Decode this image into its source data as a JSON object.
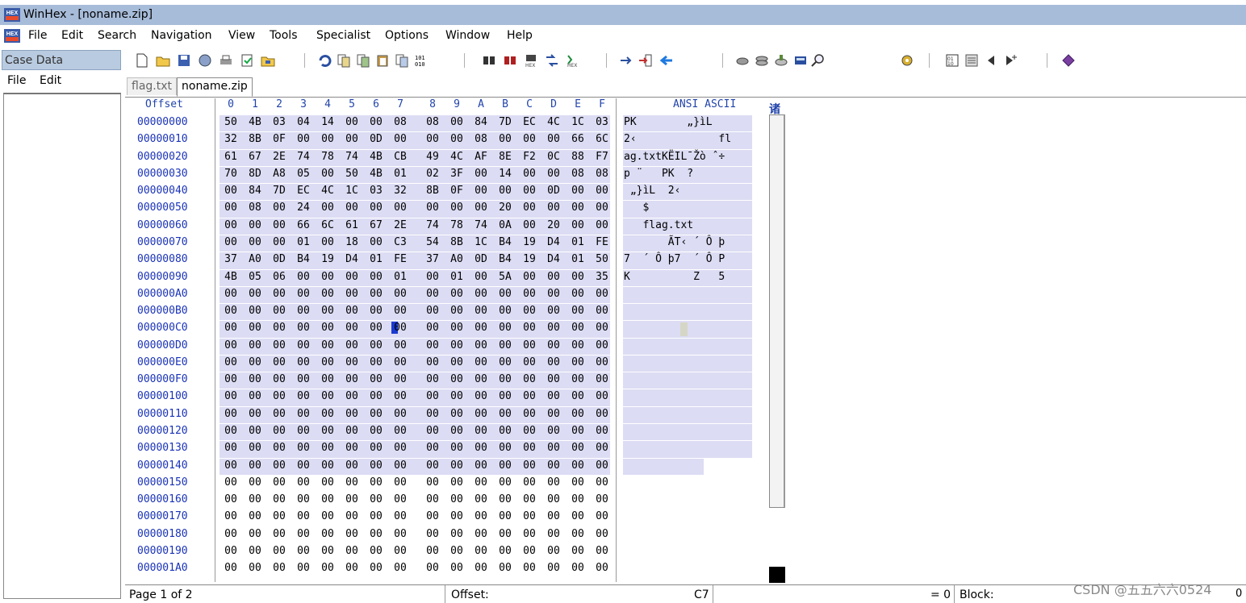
{
  "window": {
    "title": "WinHex - [noname.zip]"
  },
  "menu": [
    "File",
    "Edit",
    "Search",
    "Navigation",
    "View",
    "Tools",
    "Specialist",
    "Options",
    "Window",
    "Help"
  ],
  "case_panel": {
    "header": "Case Data",
    "menu": [
      "File",
      "Edit"
    ]
  },
  "tabs": [
    "flag.txt",
    "noname.zip"
  ],
  "hex_header": {
    "offset_label": "Offset",
    "columns": [
      "0",
      "1",
      "2",
      "3",
      "4",
      "5",
      "6",
      "7",
      "8",
      "9",
      "A",
      "B",
      "C",
      "D",
      "E",
      "F"
    ],
    "ansi_label": "ANSI ASCII",
    "extra": "诸"
  },
  "rows": [
    {
      "offset": "00000000",
      "bytes": [
        "50",
        "4B",
        "03",
        "04",
        "14",
        "00",
        "00",
        "08",
        "08",
        "00",
        "84",
        "7D",
        "EC",
        "4C",
        "1C",
        "03"
      ],
      "ascii": "PK        „}ìL"
    },
    {
      "offset": "00000010",
      "bytes": [
        "32",
        "8B",
        "0F",
        "00",
        "00",
        "00",
        "0D",
        "00",
        "00",
        "00",
        "08",
        "00",
        "00",
        "00",
        "66",
        "6C"
      ],
      "ascii": "2‹             fl"
    },
    {
      "offset": "00000020",
      "bytes": [
        "61",
        "67",
        "2E",
        "74",
        "78",
        "74",
        "4B",
        "CB",
        "49",
        "4C",
        "AF",
        "8E",
        "F2",
        "0C",
        "88",
        "F7"
      ],
      "ascii": "ag.txtKËIL¯Žò ˆ÷"
    },
    {
      "offset": "00000030",
      "bytes": [
        "70",
        "8D",
        "A8",
        "05",
        "00",
        "50",
        "4B",
        "01",
        "02",
        "3F",
        "00",
        "14",
        "00",
        "00",
        "08",
        "08"
      ],
      "ascii": "p ¨   PK  ?"
    },
    {
      "offset": "00000040",
      "bytes": [
        "00",
        "84",
        "7D",
        "EC",
        "4C",
        "1C",
        "03",
        "32",
        "8B",
        "0F",
        "00",
        "00",
        "00",
        "0D",
        "00",
        "00"
      ],
      "ascii": " „}ìL  2‹"
    },
    {
      "offset": "00000050",
      "bytes": [
        "00",
        "08",
        "00",
        "24",
        "00",
        "00",
        "00",
        "00",
        "00",
        "00",
        "00",
        "20",
        "00",
        "00",
        "00",
        "00"
      ],
      "ascii": "   $"
    },
    {
      "offset": "00000060",
      "bytes": [
        "00",
        "00",
        "00",
        "66",
        "6C",
        "61",
        "67",
        "2E",
        "74",
        "78",
        "74",
        "0A",
        "00",
        "20",
        "00",
        "00"
      ],
      "ascii": "   flag.txt"
    },
    {
      "offset": "00000070",
      "bytes": [
        "00",
        "00",
        "00",
        "01",
        "00",
        "18",
        "00",
        "C3",
        "54",
        "8B",
        "1C",
        "B4",
        "19",
        "D4",
        "01",
        "FE"
      ],
      "ascii": "       ÃT‹ ´ Ô þ"
    },
    {
      "offset": "00000080",
      "bytes": [
        "37",
        "A0",
        "0D",
        "B4",
        "19",
        "D4",
        "01",
        "FE",
        "37",
        "A0",
        "0D",
        "B4",
        "19",
        "D4",
        "01",
        "50"
      ],
      "ascii": "7  ´ Ô þ7  ´ Ô P"
    },
    {
      "offset": "00000090",
      "bytes": [
        "4B",
        "05",
        "06",
        "00",
        "00",
        "00",
        "00",
        "01",
        "00",
        "01",
        "00",
        "5A",
        "00",
        "00",
        "00",
        "35"
      ],
      "ascii": "K          Z   5"
    },
    {
      "offset": "000000A0",
      "bytes": [
        "00",
        "00",
        "00",
        "00",
        "00",
        "00",
        "00",
        "00",
        "00",
        "00",
        "00",
        "00",
        "00",
        "00",
        "00",
        "00"
      ],
      "ascii": ""
    },
    {
      "offset": "000000B0",
      "bytes": [
        "00",
        "00",
        "00",
        "00",
        "00",
        "00",
        "00",
        "00",
        "00",
        "00",
        "00",
        "00",
        "00",
        "00",
        "00",
        "00"
      ],
      "ascii": ""
    },
    {
      "offset": "000000C0",
      "bytes": [
        "00",
        "00",
        "00",
        "00",
        "00",
        "00",
        "00",
        "00",
        "00",
        "00",
        "00",
        "00",
        "00",
        "00",
        "00",
        "00"
      ],
      "ascii": ""
    },
    {
      "offset": "000000D0",
      "bytes": [
        "00",
        "00",
        "00",
        "00",
        "00",
        "00",
        "00",
        "00",
        "00",
        "00",
        "00",
        "00",
        "00",
        "00",
        "00",
        "00"
      ],
      "ascii": ""
    },
    {
      "offset": "000000E0",
      "bytes": [
        "00",
        "00",
        "00",
        "00",
        "00",
        "00",
        "00",
        "00",
        "00",
        "00",
        "00",
        "00",
        "00",
        "00",
        "00",
        "00"
      ],
      "ascii": ""
    },
    {
      "offset": "000000F0",
      "bytes": [
        "00",
        "00",
        "00",
        "00",
        "00",
        "00",
        "00",
        "00",
        "00",
        "00",
        "00",
        "00",
        "00",
        "00",
        "00",
        "00"
      ],
      "ascii": ""
    },
    {
      "offset": "00000100",
      "bytes": [
        "00",
        "00",
        "00",
        "00",
        "00",
        "00",
        "00",
        "00",
        "00",
        "00",
        "00",
        "00",
        "00",
        "00",
        "00",
        "00"
      ],
      "ascii": ""
    },
    {
      "offset": "00000110",
      "bytes": [
        "00",
        "00",
        "00",
        "00",
        "00",
        "00",
        "00",
        "00",
        "00",
        "00",
        "00",
        "00",
        "00",
        "00",
        "00",
        "00"
      ],
      "ascii": ""
    },
    {
      "offset": "00000120",
      "bytes": [
        "00",
        "00",
        "00",
        "00",
        "00",
        "00",
        "00",
        "00",
        "00",
        "00",
        "00",
        "00",
        "00",
        "00",
        "00",
        "00"
      ],
      "ascii": ""
    },
    {
      "offset": "00000130",
      "bytes": [
        "00",
        "00",
        "00",
        "00",
        "00",
        "00",
        "00",
        "00",
        "00",
        "00",
        "00",
        "00",
        "00",
        "00",
        "00",
        "00"
      ],
      "ascii": ""
    },
    {
      "offset": "00000140",
      "bytes": [
        "00",
        "00",
        "00",
        "00",
        "00",
        "00",
        "00",
        "00",
        "00",
        "00",
        "00",
        "00",
        "00",
        "00",
        "00",
        "00"
      ],
      "ascii": ""
    },
    {
      "offset": "00000150",
      "bytes": [
        "00",
        "00",
        "00",
        "00",
        "00",
        "00",
        "00",
        "00",
        "00",
        "00",
        "00",
        "00",
        "00",
        "00",
        "00",
        "00"
      ],
      "ascii": ""
    },
    {
      "offset": "00000160",
      "bytes": [
        "00",
        "00",
        "00",
        "00",
        "00",
        "00",
        "00",
        "00",
        "00",
        "00",
        "00",
        "00",
        "00",
        "00",
        "00",
        "00"
      ],
      "ascii": ""
    },
    {
      "offset": "00000170",
      "bytes": [
        "00",
        "00",
        "00",
        "00",
        "00",
        "00",
        "00",
        "00",
        "00",
        "00",
        "00",
        "00",
        "00",
        "00",
        "00",
        "00"
      ],
      "ascii": ""
    },
    {
      "offset": "00000180",
      "bytes": [
        "00",
        "00",
        "00",
        "00",
        "00",
        "00",
        "00",
        "00",
        "00",
        "00",
        "00",
        "00",
        "00",
        "00",
        "00",
        "00"
      ],
      "ascii": ""
    },
    {
      "offset": "00000190",
      "bytes": [
        "00",
        "00",
        "00",
        "00",
        "00",
        "00",
        "00",
        "00",
        "00",
        "00",
        "00",
        "00",
        "00",
        "00",
        "00",
        "00"
      ],
      "ascii": ""
    },
    {
      "offset": "000001A0",
      "bytes": [
        "00",
        "00",
        "00",
        "00",
        "00",
        "00",
        "00",
        "00",
        "00",
        "00",
        "00",
        "00",
        "00",
        "00",
        "00",
        "00"
      ],
      "ascii": ""
    }
  ],
  "highlighted_rows": 21,
  "cursor": {
    "row": 12,
    "col": 7
  },
  "status": {
    "page": "Page 1 of 2",
    "offset_label": "Offset:",
    "offset_value": "C7",
    "eq": "= 0",
    "block_label": "Block:"
  },
  "watermark": "CSDN @五五六六0524",
  "watermark_tail": "0"
}
